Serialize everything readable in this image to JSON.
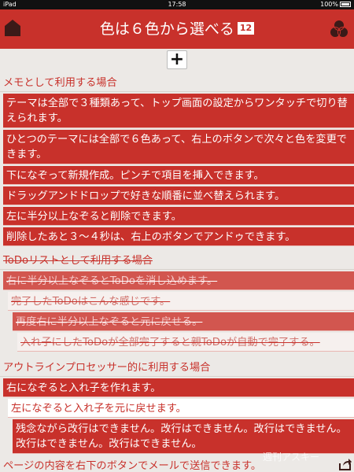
{
  "status": {
    "carrier": "iPad",
    "time": "17:58",
    "battery": "100%"
  },
  "header": {
    "title": "色は６色から選べる",
    "badge": "12",
    "left_icon": "home-icon",
    "right_icon": "color-palette-icon"
  },
  "toolbar": {
    "add_label": "+"
  },
  "sections": [
    {
      "heading": "メモとして利用する場合",
      "items": [
        "テーマは全部で３種類あって、トップ画面の設定からワンタッチで切り替えられます。",
        "ひとつのテーマには全部で６色あって、右上のボタンで次々と色を変更できます。",
        "下になぞって新規作成。ピンチで項目を挿入できます。",
        "ドラッグアンドドロップで好きな順番に並べ替えられます。",
        "左に半分以上なぞると削除できます。",
        "削除したあと３～４秒は、右上のボタンでアンドゥできます。"
      ]
    },
    {
      "heading": "ToDoリストとして利用する場合",
      "items": [
        "右に半分以上なぞるとToDoを消し込めます。",
        "完了したToDoはこんな感じです。",
        "再度右に半分以上なぞると元に戻せる。",
        "入れ子にしたToDoが全部完了すると親ToDoが自動で完了する。"
      ]
    },
    {
      "heading": "アウトラインプロセッサー的に利用する場合",
      "items": [
        "右になぞると入れ子を作れます。",
        "左になぞると入れ子を元に戻せます。",
        "残念ながら改行はできません。改行はできません。改行はできません。改行はできません。改行はできません。"
      ]
    }
  ],
  "footer": {
    "text": "ページの内容を右下のボタンでメールで送信できます。",
    "watermark": "週刊アスキー",
    "icon": "share-icon"
  }
}
